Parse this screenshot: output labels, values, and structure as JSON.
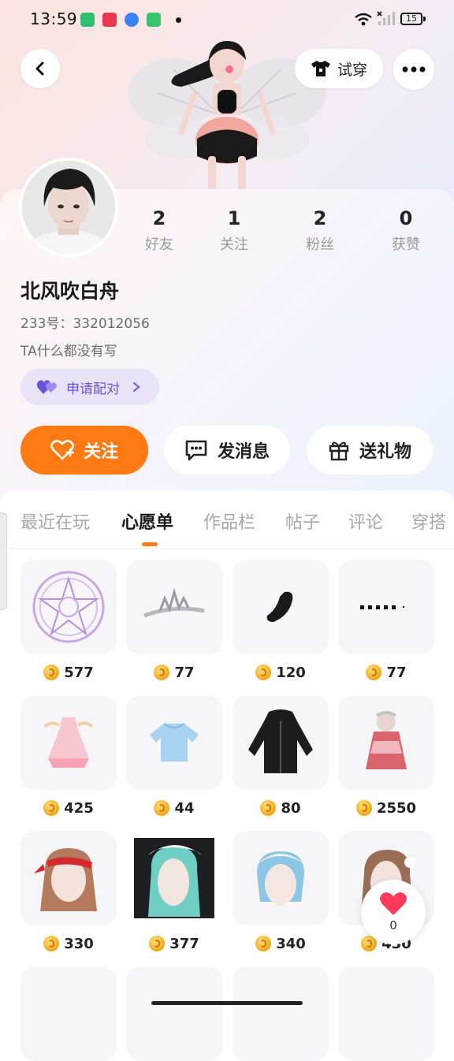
{
  "status_bar": {
    "time": "13:59",
    "battery": "15",
    "app_icons": [
      {
        "name": "app-green-icon",
        "color": "#2fbf71"
      },
      {
        "name": "app-red-video-icon",
        "color": "#e8384f"
      },
      {
        "name": "app-blue-icon",
        "color": "#3b82f6"
      },
      {
        "name": "app-android-icon",
        "color": "#36c46b"
      }
    ]
  },
  "header": {
    "tryon_label": "试穿"
  },
  "profile": {
    "username": "北风吹白舟",
    "uid": "233号：332012056",
    "bio": "TA什么都没有写",
    "pair_label": "申请配对",
    "stats": [
      {
        "num": "2",
        "label": "好友"
      },
      {
        "num": "1",
        "label": "关注"
      },
      {
        "num": "2",
        "label": "粉丝"
      },
      {
        "num": "0",
        "label": "获赞"
      }
    ]
  },
  "actions": {
    "follow": "关注",
    "message": "发消息",
    "gift": "送礼物"
  },
  "tabs": [
    {
      "label": "最近在玩"
    },
    {
      "label": "心愿单"
    },
    {
      "label": "作品栏"
    },
    {
      "label": "帖子"
    },
    {
      "label": "评论"
    },
    {
      "label": "穿搭"
    }
  ],
  "active_tab": "心愿单",
  "wishlist": [
    {
      "price": "577",
      "icon": "magic-circle-icon"
    },
    {
      "price": "77",
      "icon": "tiara-icon"
    },
    {
      "price": "120",
      "icon": "black-shoe-icon"
    },
    {
      "price": "77",
      "icon": "dotted-line-icon"
    },
    {
      "price": "425",
      "icon": "pink-dress-icon"
    },
    {
      "price": "44",
      "icon": "blue-top-icon"
    },
    {
      "price": "80",
      "icon": "black-hoodie-icon"
    },
    {
      "price": "2550",
      "icon": "red-outfit-icon"
    },
    {
      "price": "330",
      "icon": "red-bandana-hair-icon"
    },
    {
      "price": "377",
      "icon": "teal-hair-icon"
    },
    {
      "price": "340",
      "icon": "blue-bob-hair-icon"
    },
    {
      "price": "430",
      "icon": "brown-hair-icon"
    }
  ],
  "like_float": {
    "count": "0"
  },
  "colors": {
    "accent": "#ff7a12",
    "pair": "#6a55d8",
    "like": "#ff3b5c"
  }
}
